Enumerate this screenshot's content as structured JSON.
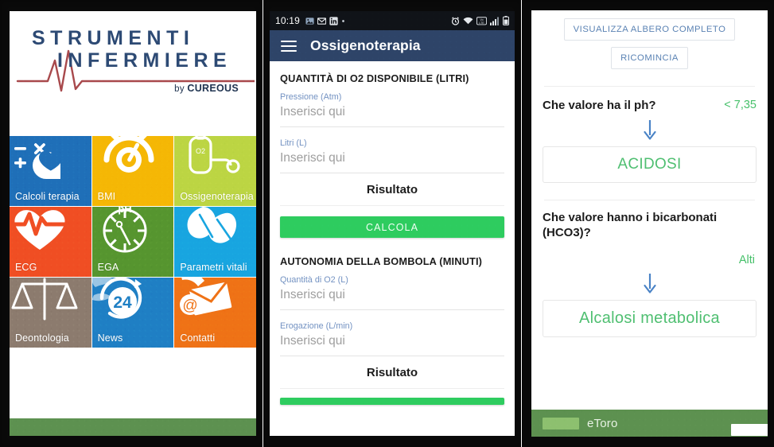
{
  "left_panel": {
    "logo": {
      "line1": "STRUMENTI",
      "line2": "INFERMIERE",
      "by_prefix": "by ",
      "brand": "CUREOUS"
    },
    "tiles": [
      {
        "label": "Calcoli terapia",
        "icon": "calculator-heart-icon",
        "color": "#1f6fb8"
      },
      {
        "label": "BMI",
        "icon": "speedometer-icon",
        "color": "#f5b705"
      },
      {
        "label": "Ossigenoterapia",
        "icon": "oxygen-cylinder-icon",
        "color": "#bcd543"
      },
      {
        "label": "ECG",
        "icon": "heart-ecg-icon",
        "color": "#f04e23"
      },
      {
        "label": "EGA",
        "icon": "ph-gauge-icon",
        "color": "#56952f"
      },
      {
        "label": "Parametri vitali",
        "icon": "leaves-icon",
        "color": "#18a5e0"
      },
      {
        "label": "Deontologia",
        "icon": "scales-icon",
        "color": "#8c7b6e"
      },
      {
        "label": "News",
        "icon": "globe-24-icon",
        "color": "#1f7fc4"
      },
      {
        "label": "Contatti",
        "icon": "mail-at-phone-icon",
        "color": "#ef7216"
      }
    ]
  },
  "middle_panel": {
    "statusbar": {
      "time": "10:19",
      "left_icons": [
        "photo-icon",
        "gmail-icon",
        "linkedin-icon",
        "dot-icon"
      ],
      "right_icons": [
        "alarm-icon",
        "wifi-icon",
        "volte-icon",
        "signal-icon",
        "battery-icon"
      ]
    },
    "appbar": {
      "menu_icon": "hamburger-icon",
      "title": "Ossigenoterapia"
    },
    "sections": [
      {
        "title": "QUANTITÀ DI O2 DISPONIBILE (LITRI)",
        "fields": [
          {
            "label": "Pressione (Atm)",
            "placeholder": "Inserisci qui",
            "value": ""
          },
          {
            "label": "Litri (L)",
            "placeholder": "Inserisci qui",
            "value": ""
          }
        ],
        "result_label": "Risultato",
        "button_label": "CALCOLA"
      },
      {
        "title": "AUTONOMIA DELLA BOMBOLA (MINUTI)",
        "fields": [
          {
            "label": "Quantità di O2 (L)",
            "placeholder": "Inserisci qui",
            "value": ""
          },
          {
            "label": "Erogazione (L/min)",
            "placeholder": "Inserisci qui",
            "value": ""
          }
        ],
        "result_label": "Risultato",
        "button_label": ""
      }
    ]
  },
  "right_panel": {
    "buttons": {
      "full_tree": "VISUALIZZA ALBERO COMPLETO",
      "restart": "RICOMINCIA"
    },
    "steps": [
      {
        "question": "Che valore ha il ph?",
        "answer": "< 7,35",
        "arrow_icon": "arrow-down-icon",
        "result": "ACIDOSI"
      },
      {
        "question": "Che valore hanno i bicarbonati (HCO3)?",
        "answer": "Alti",
        "arrow_icon": "arrow-down-icon",
        "result": "Alcalosi metabolica"
      }
    ],
    "ad": {
      "brand": "eToro",
      "logo_icon": "etoro-logo-icon",
      "cta_icon": "install-button"
    }
  },
  "colors": {
    "appbar": "#2e4468",
    "accent_green": "#2ecc5f",
    "result_green": "#4fbf71",
    "link_blue": "#5b83b4",
    "field_label_blue": "#7392c2",
    "logo_navy": "#2d4a74",
    "logo_red": "#a8494c",
    "ad_green": "#5d9150"
  }
}
